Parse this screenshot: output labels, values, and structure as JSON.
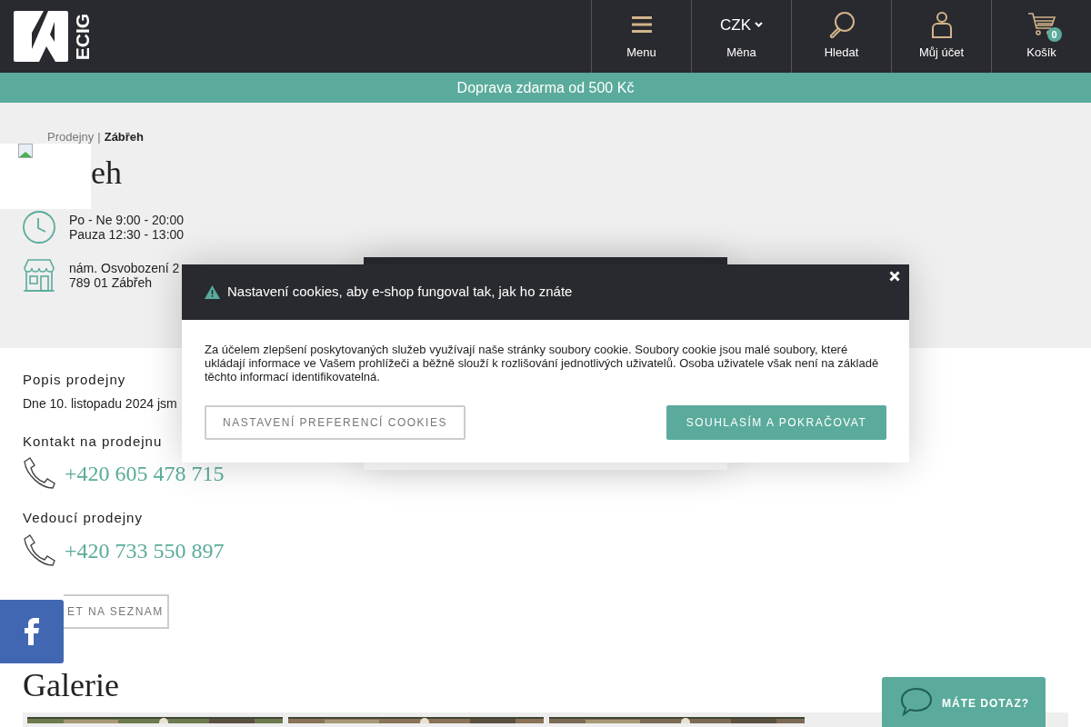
{
  "logo": {
    "text": "ECIG"
  },
  "nav": [
    {
      "kind": "menu",
      "label": "Menu"
    },
    {
      "kind": "currency",
      "value": "CZK",
      "label": "Měna"
    },
    {
      "kind": "search",
      "label": "Hledat"
    },
    {
      "kind": "account",
      "label": "Můj účet"
    },
    {
      "kind": "cart",
      "label": "Košík",
      "badge": "0"
    }
  ],
  "promo_bar": "Doprava zdarma od 500 Kč",
  "breadcrumb": {
    "items": [
      "Prodejny",
      "Zábřeh"
    ],
    "separator": "|"
  },
  "heading": "eh",
  "hours": [
    "Po - Ne 9:00 - 20:00",
    "Pauza 12:30 - 13:00"
  ],
  "address": [
    "nám. Osvobození 2",
    "789 01 Zábřeh"
  ],
  "description": {
    "title": "Popis prodejny",
    "text": "Dne 10. listopadu 2024 jsm"
  },
  "contacts": [
    {
      "title": "Kontakt na prodejnu",
      "phone": "+420 605 478 715"
    },
    {
      "title": "Vedoucí prodejny",
      "phone": "+420 733 550 897"
    }
  ],
  "back_button": "ET NA SEZNAM",
  "gallery": {
    "title": "Galerie"
  },
  "chat_button": "MÁTE DOTAZ?",
  "cookie_dialog": {
    "title": "Nastavení cookies, aby e-shop fungoval tak, jak ho znáte",
    "text": "Za účelem zlepšení poskytovaných služeb využívají naše stránky soubory cookie. Soubory cookie jsou malé soubory, které ukládají informace ve Vašem prohlížeči a běžně slouží k rozlišování jednotlivých uživatelů. Osoba uživatele však není na základě těchto informací identifikovatelná.",
    "buttons": [
      {
        "kind": "secondary",
        "label": "NASTAVENÍ PREFERENCÍ COOKIES"
      },
      {
        "kind": "primary",
        "label": "SOUHLASÍM A POKRAČOVAT"
      }
    ]
  }
}
